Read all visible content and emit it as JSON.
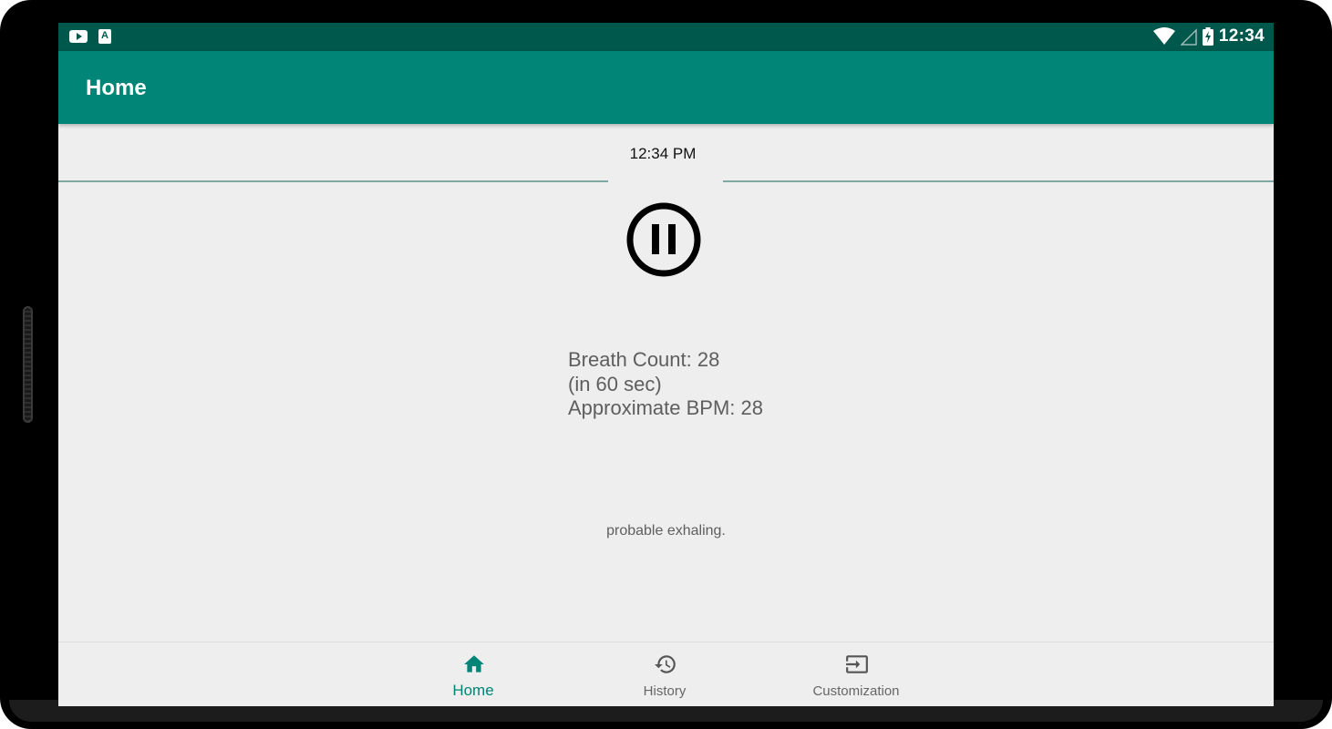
{
  "status_bar": {
    "time": "12:34",
    "left_icons": [
      "youtube-icon",
      "text-a-icon"
    ],
    "right_icons": [
      "wifi-icon",
      "cell-signal-icon",
      "battery-charging-icon"
    ],
    "a_icon_letter": "A"
  },
  "app_bar": {
    "title": "Home"
  },
  "home": {
    "current_time": "12:34 PM",
    "pause_button_icon": "pause-circle-icon",
    "breath_count_line": "Breath Count: 28",
    "duration_line": "(in 60 sec)",
    "bpm_line": "Approximate BPM: 28",
    "breathing_status": "probable exhaling."
  },
  "bottom_nav": {
    "items": [
      {
        "label": "Home",
        "icon": "home-icon",
        "active": true
      },
      {
        "label": "History",
        "icon": "history-icon",
        "active": false
      },
      {
        "label": "Customization",
        "icon": "input-icon",
        "active": false
      }
    ]
  },
  "colors": {
    "status_bar": "#00574b",
    "app_bar": "#008577",
    "background": "#eeeeee",
    "active_nav": "#008577",
    "text_secondary": "#5e5e5e"
  }
}
